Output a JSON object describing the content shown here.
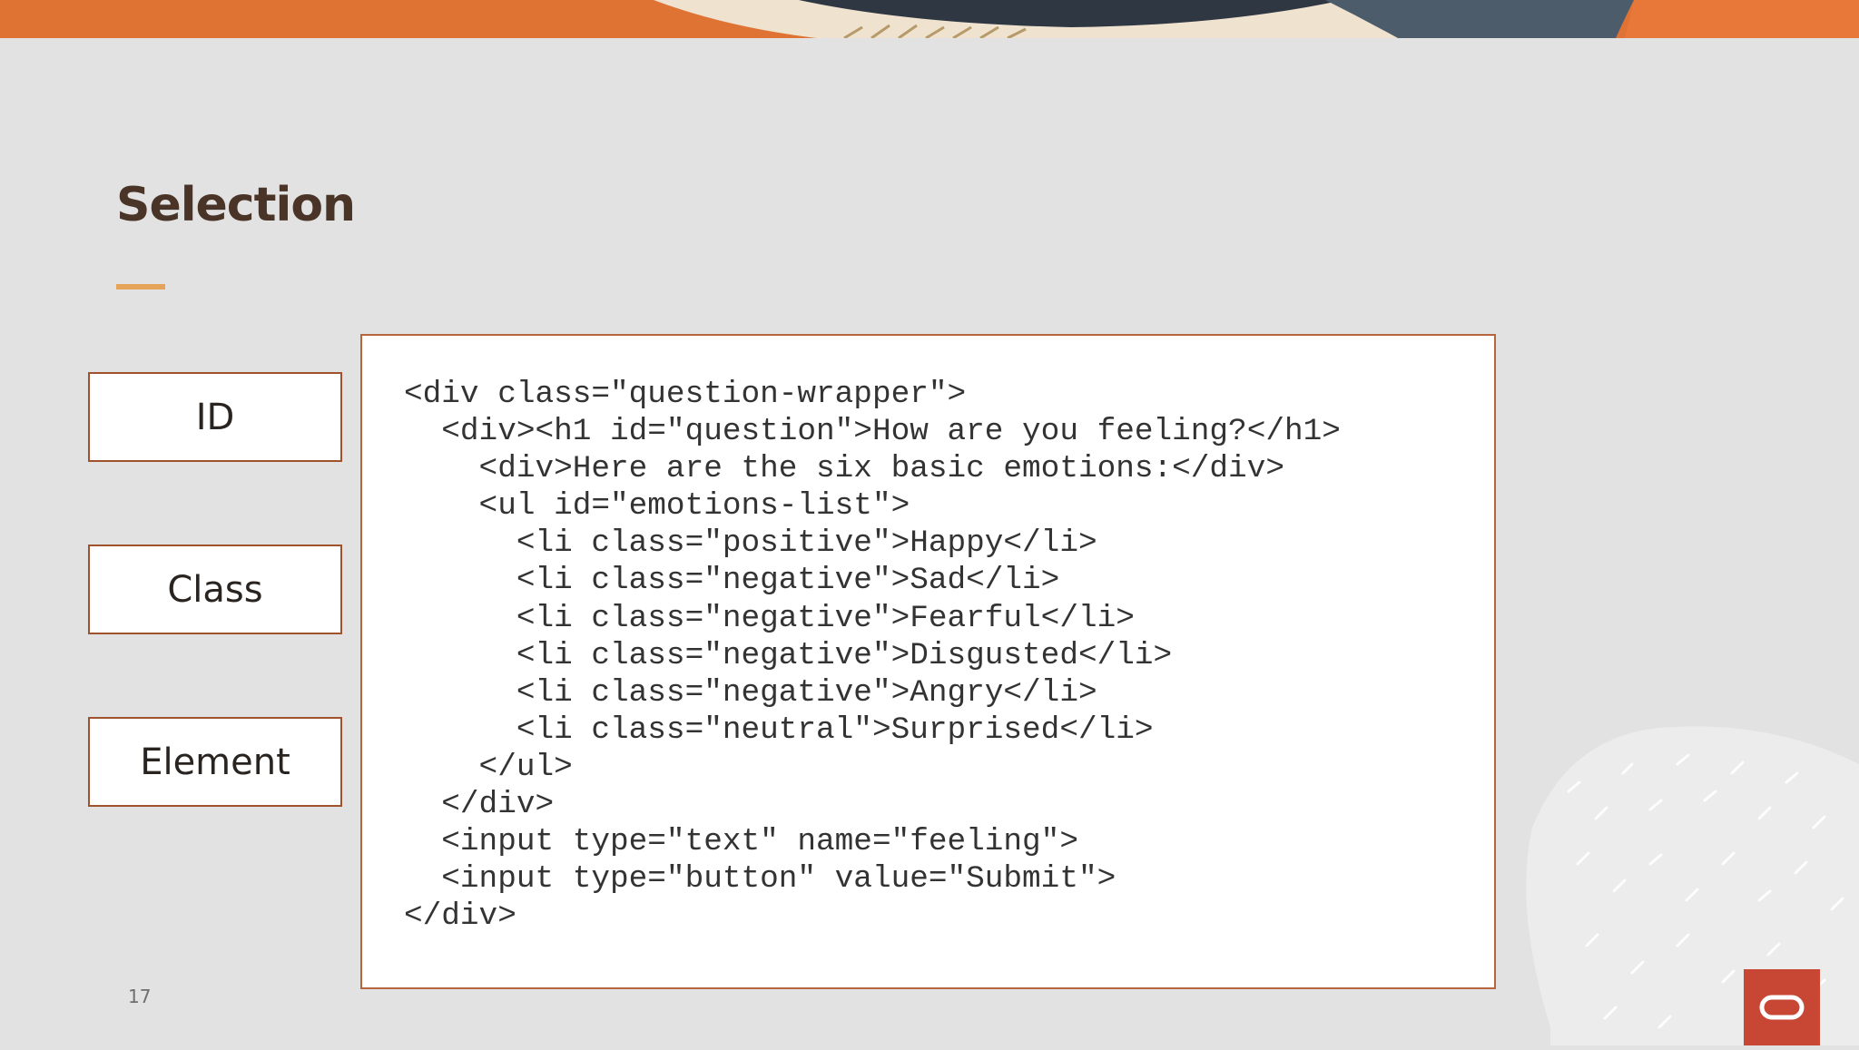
{
  "slide": {
    "title": "Selection",
    "page_number": "17"
  },
  "selectors": {
    "id_label": "ID",
    "class_label": "Class",
    "element_label": "Element"
  },
  "code": {
    "lines": [
      "<div class=\"question-wrapper\">",
      "  <div><h1 id=\"question\">How are you feeling?</h1>",
      "    <div>Here are the six basic emotions:</div>",
      "    <ul id=\"emotions-list\">",
      "      <li class=\"positive\">Happy</li>",
      "      <li class=\"negative\">Sad</li>",
      "      <li class=\"negative\">Fearful</li>",
      "      <li class=\"negative\">Disgusted</li>",
      "      <li class=\"negative\">Angry</li>",
      "      <li class=\"neutral\">Surprised</li>",
      "    </ul>",
      "  </div>",
      "  <input type=\"text\" name=\"feeling\">",
      "  <input type=\"button\" value=\"Submit\">",
      "</div>"
    ]
  },
  "colors": {
    "background": "#e2e2e2",
    "accent_orange": "#e07a3a",
    "accent_rule": "#e6a45a",
    "box_border": "#a0522d",
    "logo_red": "#c74634",
    "title_brown": "#4a3428"
  },
  "icons": {
    "logo": "oracle-logo-icon"
  }
}
